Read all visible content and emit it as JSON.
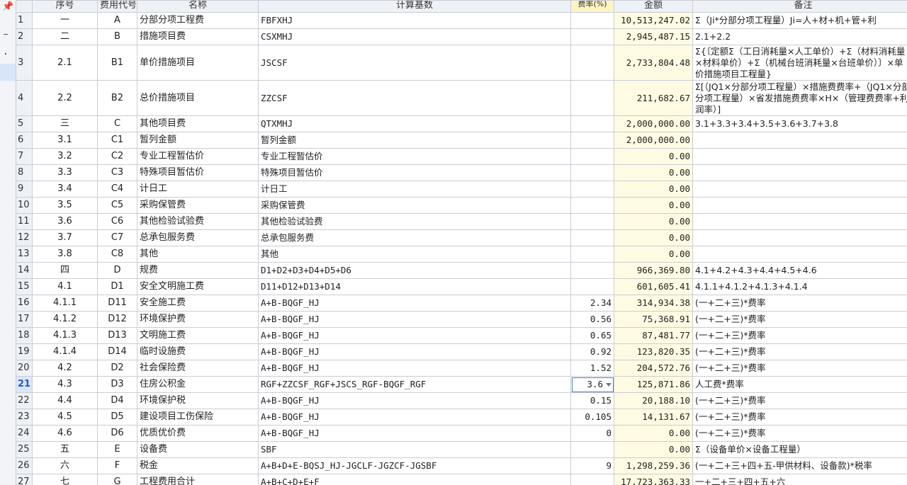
{
  "columns": {
    "row_no": "",
    "seq": "序号",
    "code": "费用代号",
    "name": "名称",
    "base": "计算基数",
    "rate": "费率(%)",
    "amount": "金额",
    "note": "备注"
  },
  "current_row": 21,
  "rows": [
    {
      "n": "1",
      "seq": "一",
      "code": "A",
      "name": "分部分项工程费",
      "base": "FBFXHJ",
      "rate": "",
      "amount": "10,513,247.02",
      "note": "Σ（Ji*分部分项工程量）Ji=人+材+机+管+利"
    },
    {
      "n": "2",
      "seq": "二",
      "code": "B",
      "name": "措施项目费",
      "base": "CSXMHJ",
      "rate": "",
      "amount": "2,945,487.15",
      "note": "2.1+2.2"
    },
    {
      "n": "3",
      "seq": "2.1",
      "code": "B1",
      "name": "单价措施项目",
      "base": "JSCSF",
      "rate": "",
      "amount": "2,733,804.48",
      "note": "Σ{〔定额Σ（工日消耗量×人工单价）+Σ（材料消耗量×材料单价）+Σ（机械台班消耗量×台班单价）〕×单价措施项目工程量}"
    },
    {
      "n": "4",
      "seq": "2.2",
      "code": "B2",
      "name": "总价措施项目",
      "base": "ZZCSF",
      "rate": "",
      "amount": "211,682.67",
      "note": "Σ[（JQ1×分部分项工程量）×措施费费率+（JQ1×分部分项工程量）×省发措施费费率×H×（管理费费率+利润率）]"
    },
    {
      "n": "5",
      "seq": "三",
      "code": "C",
      "name": "其他项目费",
      "base": "QTXMHJ",
      "rate": "",
      "amount": "2,000,000.00",
      "note": "3.1+3.3+3.4+3.5+3.6+3.7+3.8"
    },
    {
      "n": "6",
      "seq": "3.1",
      "code": "C1",
      "name": "暂列金额",
      "base": "暂列金额",
      "rate": "",
      "amount": "2,000,000.00",
      "note": ""
    },
    {
      "n": "7",
      "seq": "3.2",
      "code": "C2",
      "name": "专业工程暂估价",
      "base": "专业工程暂估价",
      "rate": "",
      "amount": "0.00",
      "note": ""
    },
    {
      "n": "8",
      "seq": "3.3",
      "code": "C3",
      "name": "特殊项目暂估价",
      "base": "特殊项目暂估价",
      "rate": "",
      "amount": "0.00",
      "note": ""
    },
    {
      "n": "9",
      "seq": "3.4",
      "code": "C4",
      "name": "计日工",
      "base": "计日工",
      "rate": "",
      "amount": "0.00",
      "note": ""
    },
    {
      "n": "10",
      "seq": "3.5",
      "code": "C5",
      "name": "采购保管费",
      "base": "采购保管费",
      "rate": "",
      "amount": "0.00",
      "note": ""
    },
    {
      "n": "11",
      "seq": "3.6",
      "code": "C6",
      "name": "其他检验试验费",
      "base": "其他检验试验费",
      "rate": "",
      "amount": "0.00",
      "note": ""
    },
    {
      "n": "12",
      "seq": "3.7",
      "code": "C7",
      "name": "总承包服务费",
      "base": "总承包服务费",
      "rate": "",
      "amount": "0.00",
      "note": ""
    },
    {
      "n": "13",
      "seq": "3.8",
      "code": "C8",
      "name": "其他",
      "base": "其他",
      "rate": "",
      "amount": "0.00",
      "note": ""
    },
    {
      "n": "14",
      "seq": "四",
      "code": "D",
      "name": "规费",
      "base": "D1+D2+D3+D4+D5+D6",
      "rate": "",
      "amount": "966,369.80",
      "note": "4.1+4.2+4.3+4.4+4.5+4.6"
    },
    {
      "n": "15",
      "seq": "4.1",
      "code": "D1",
      "name": "安全文明施工费",
      "base": "D11+D12+D13+D14",
      "rate": "",
      "amount": "601,605.41",
      "note": "4.1.1+4.1.2+4.1.3+4.1.4"
    },
    {
      "n": "16",
      "seq": "4.1.1",
      "code": "D11",
      "name": "安全施工费",
      "base": "A+B-BQGF_HJ",
      "rate": "2.34",
      "amount": "314,934.38",
      "note": "(一+二+三)*费率"
    },
    {
      "n": "17",
      "seq": "4.1.2",
      "code": "D12",
      "name": "环境保护费",
      "base": "A+B-BQGF_HJ",
      "rate": "0.56",
      "amount": "75,368.91",
      "note": "(一+二+三)*费率"
    },
    {
      "n": "18",
      "seq": "4.1.3",
      "code": "D13",
      "name": "文明施工费",
      "base": "A+B-BQGF_HJ",
      "rate": "0.65",
      "amount": "87,481.77",
      "note": "(一+二+三)*费率"
    },
    {
      "n": "19",
      "seq": "4.1.4",
      "code": "D14",
      "name": "临时设施费",
      "base": "A+B-BQGF_HJ",
      "rate": "0.92",
      "amount": "123,820.35",
      "note": "(一+二+三)*费率"
    },
    {
      "n": "20",
      "seq": "4.2",
      "code": "D2",
      "name": "社会保险费",
      "base": "A+B-BQGF_HJ",
      "rate": "1.52",
      "amount": "204,572.76",
      "note": "(一+二+三)*费率"
    },
    {
      "n": "21",
      "seq": "4.3",
      "code": "D3",
      "name": "住房公积金",
      "base": "RGF+ZZCSF_RGF+JSCS_RGF-BQGF_RGF",
      "rate": "3.6",
      "amount": "125,871.86",
      "note": "人工费*费率"
    },
    {
      "n": "22",
      "seq": "4.4",
      "code": "D4",
      "name": "环境保护税",
      "base": "A+B-BQGF_HJ",
      "rate": "0.15",
      "amount": "20,188.10",
      "note": "(一+二+三)*费率"
    },
    {
      "n": "23",
      "seq": "4.5",
      "code": "D5",
      "name": "建设项目工伤保险",
      "base": "A+B-BQGF_HJ",
      "rate": "0.105",
      "amount": "14,131.67",
      "note": "(一+二+三)*费率"
    },
    {
      "n": "24",
      "seq": "4.6",
      "code": "D6",
      "name": "优质优价费",
      "base": "A+B-BQGF_HJ",
      "rate": "0",
      "amount": "0.00",
      "note": "(一+二+三)*费率"
    },
    {
      "n": "25",
      "seq": "五",
      "code": "E",
      "name": "设备费",
      "base": "SBF",
      "rate": "",
      "amount": "0.00",
      "note": "Σ（设备单价×设备工程量）"
    },
    {
      "n": "26",
      "seq": "六",
      "code": "F",
      "name": "税金",
      "base": "A+B+D+E-BQSJ_HJ-JGCLF-JGZCF-JGSBF",
      "rate": "9",
      "amount": "1,298,259.36",
      "note": "(一+二+三+四+五-甲供材料、设备款)*税率"
    },
    {
      "n": "27",
      "seq": "七",
      "code": "G",
      "name": "工程费用合计",
      "base": "A+B+C+D+E+F",
      "rate": "",
      "amount": "17,723,363.33",
      "note": "一+二+三+四+五+六"
    }
  ],
  "icons": {
    "sidebar_pin": "pin-icon",
    "dropdown": "chevron-down-icon"
  },
  "colors": {
    "amount_bg": "#fffbe3",
    "header_bg": "#eef1f6",
    "selection": "#4a7cd8"
  }
}
